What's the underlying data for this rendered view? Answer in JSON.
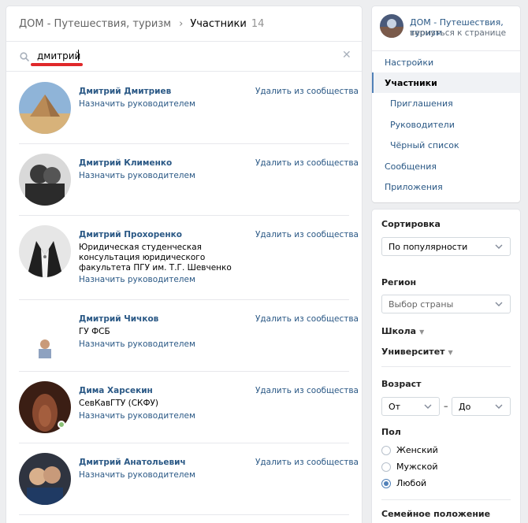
{
  "breadcrumb": {
    "group": "ДОМ - Путешествия, туризм",
    "separator": "›",
    "current": "Участники",
    "count": "14"
  },
  "search": {
    "value": "дмитрий"
  },
  "members": [
    {
      "name": "Дмитрий Дмитриев",
      "details": "",
      "action": "Назначить руководителем",
      "remove": "Удалить из сообщества",
      "online": false
    },
    {
      "name": "Дмитрий Клименко",
      "details": "",
      "action": "Назначить руководителем",
      "remove": "Удалить из сообщества",
      "online": false
    },
    {
      "name": "Дмитрий Прохоренко",
      "details": "Юридическая студенческая консультация юридического факультета ПГУ им. Т.Г. Шевченко",
      "action": "Назначить руководителем",
      "remove": "Удалить из сообщества",
      "online": false
    },
    {
      "name": "Дмитрий Чичков",
      "details": "ГУ ФСБ",
      "action": "Назначить руководителем",
      "remove": "Удалить из сообщества",
      "online": false
    },
    {
      "name": "Дима Харсекин",
      "details": "СевКавГТУ (СКФУ)",
      "action": "Назначить руководителем",
      "remove": "Удалить из сообщества",
      "online": true
    },
    {
      "name": "Дмитрий Анатольевич",
      "details": "",
      "action": "Назначить руководителем",
      "remove": "Удалить из сообщества",
      "online": false
    }
  ],
  "group_card": {
    "title": "ДОМ - Путешествия, туризм",
    "subtitle": "вернуться к странице"
  },
  "nav": [
    {
      "label": "Настройки"
    },
    {
      "label": "Участники"
    },
    {
      "label": "Приглашения"
    },
    {
      "label": "Руководители"
    },
    {
      "label": "Чёрный список"
    },
    {
      "label": "Сообщения"
    },
    {
      "label": "Приложения"
    }
  ],
  "filters": {
    "sort_label": "Сортировка",
    "sort_value": "По популярности",
    "region_label": "Регион",
    "region_placeholder": "Выбор страны",
    "school_label": "Школа",
    "university_label": "Университет",
    "age_label": "Возраст",
    "age_from": "От",
    "age_dash": "–",
    "age_to": "До",
    "sex_label": "Пол",
    "sex_options": [
      "Женский",
      "Мужской",
      "Любой"
    ],
    "sex_selected": "Любой",
    "family_label": "Семейное положение"
  },
  "colors": {
    "link": "#2a5885",
    "accent": "#5181b8",
    "online": "#8ac176",
    "search_underline": "#e0282a"
  }
}
